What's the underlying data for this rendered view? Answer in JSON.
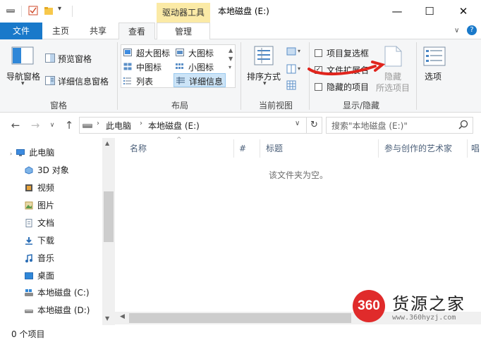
{
  "title_bar": {
    "context_tab_title": "驱动器工具",
    "window_title": "本地磁盘 (E:)",
    "minimize": "—",
    "maximize": "☐",
    "close": "✕"
  },
  "ribbon_tabs": {
    "file": "文件",
    "home": "主页",
    "share": "共享",
    "view": "查看",
    "manage": "管理"
  },
  "ribbon": {
    "panes": {
      "nav_pane": "导航窗格",
      "preview_pane": "预览窗格",
      "details_pane": "详细信息窗格",
      "label": "窗格"
    },
    "layout": {
      "extra_large_icons": "超大图标",
      "large_icons": "大图标",
      "medium_icons": "中图标",
      "small_icons": "小图标",
      "list": "列表",
      "details": "详细信息",
      "label": "布局"
    },
    "current_view": {
      "sort_by": "排序方式",
      "label": "当前视图"
    },
    "show_hide": {
      "item_checkboxes": "项目复选框",
      "file_extensions": "文件扩展名",
      "hidden_items": "隐藏的项目",
      "hide_selected_line1": "隐藏",
      "hide_selected_line2": "所选项目",
      "label": "显示/隐藏"
    },
    "options": "选项"
  },
  "address_bar": {
    "crumb_1": "此电脑",
    "crumb_2": "本地磁盘 (E:)",
    "search_placeholder": "搜索\"本地磁盘 (E:)\""
  },
  "nav_pane": {
    "items": [
      {
        "label": "此电脑"
      },
      {
        "label": "3D 对象"
      },
      {
        "label": "视频"
      },
      {
        "label": "图片"
      },
      {
        "label": "文档"
      },
      {
        "label": "下载"
      },
      {
        "label": "音乐"
      },
      {
        "label": "桌面"
      },
      {
        "label": "本地磁盘 (C:)"
      },
      {
        "label": "本地磁盘 (D:)"
      }
    ]
  },
  "content": {
    "columns": [
      "名称",
      "#",
      "标题",
      "参与创作的艺术家",
      "唱"
    ],
    "empty_message": "该文件夹为空。"
  },
  "status_bar": {
    "item_count": "0 个项目"
  },
  "watermark": {
    "logo": "360",
    "name": "货源之家",
    "url": "www.360hyzj.com"
  },
  "colors": {
    "accent": "#1979ca",
    "context_tab": "#fbeaa6",
    "annotation": "#e0241c"
  }
}
